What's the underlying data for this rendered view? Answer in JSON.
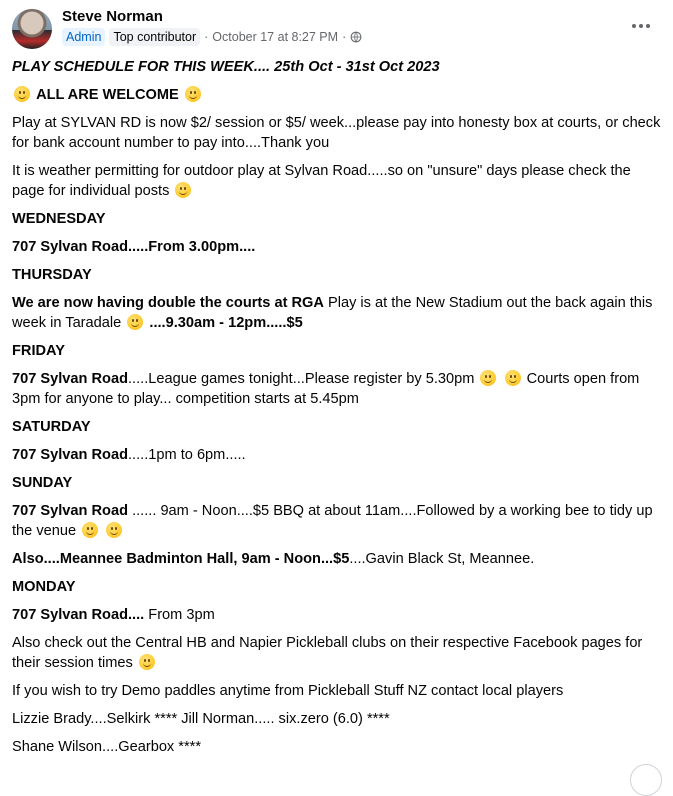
{
  "post": {
    "author": "Steve Norman",
    "badges": [
      "Admin",
      "Top contributor"
    ],
    "timestamp": "October 17 at 8:27 PM",
    "sep": "·",
    "visibility_icon": "globe-icon",
    "more_icon": "more-horizontal-icon"
  },
  "content": {
    "title": "PLAY SCHEDULE FOR THIS WEEK.... 25th Oct - 31st Oct 2023",
    "welcome": "ALL ARE WELCOME",
    "fees": "Play at SYLVAN RD is now $2/ session or $5/ week...please pay into honesty box at courts, or check for bank account number to pay into....Thank you",
    "weather": "It is weather permitting for outdoor play at Sylvan Road.....so on \"unsure\" days please check the page for individual posts",
    "days": {
      "wed": "WEDNESDAY",
      "thu": "THURSDAY",
      "fri": "FRIDAY",
      "sat": "SATURDAY",
      "sun": "SUNDAY",
      "mon": "MONDAY"
    },
    "wed_line": "707 Sylvan Road.....From 3.00pm....",
    "thu_bold": "We are now having double the courts at RGA",
    "thu_rest": "Play is at the New Stadium out the back again this week in Taradale",
    "thu_time": "....9.30am - 12pm.....$5",
    "fri_bold": "707 Sylvan Road",
    "fri_rest": ".....League games tonight...Please register by 5.30pm",
    "fri_tail": "Courts open from 3pm for anyone to play... competition starts at 5.45pm",
    "sat_bold": "707 Sylvan Road",
    "sat_rest": ".....1pm to 6pm.....",
    "sun_bold": "707 Sylvan Road",
    "sun_rest": "...... 9am - Noon....$5 BBQ at about 11am....Followed by a working bee to tidy up the venue",
    "sun2_bold": "Also....Meannee Badminton Hall, 9am - Noon...$5",
    "sun2_rest": "....Gavin Black St, Meannee.",
    "mon_bold": "707 Sylvan Road....",
    "mon_rest": " From 3pm",
    "clubs": "Also check out the Central HB and Napier Pickleball clubs on their respective Facebook pages for their session times",
    "demo": "If you wish to try Demo paddles anytime from Pickleball Stuff NZ contact local players",
    "players1": "Lizzie Brady....Selkirk **** Jill Norman..... six.zero (6.0) ****",
    "players2": "Shane Wilson....Gearbox ****"
  }
}
